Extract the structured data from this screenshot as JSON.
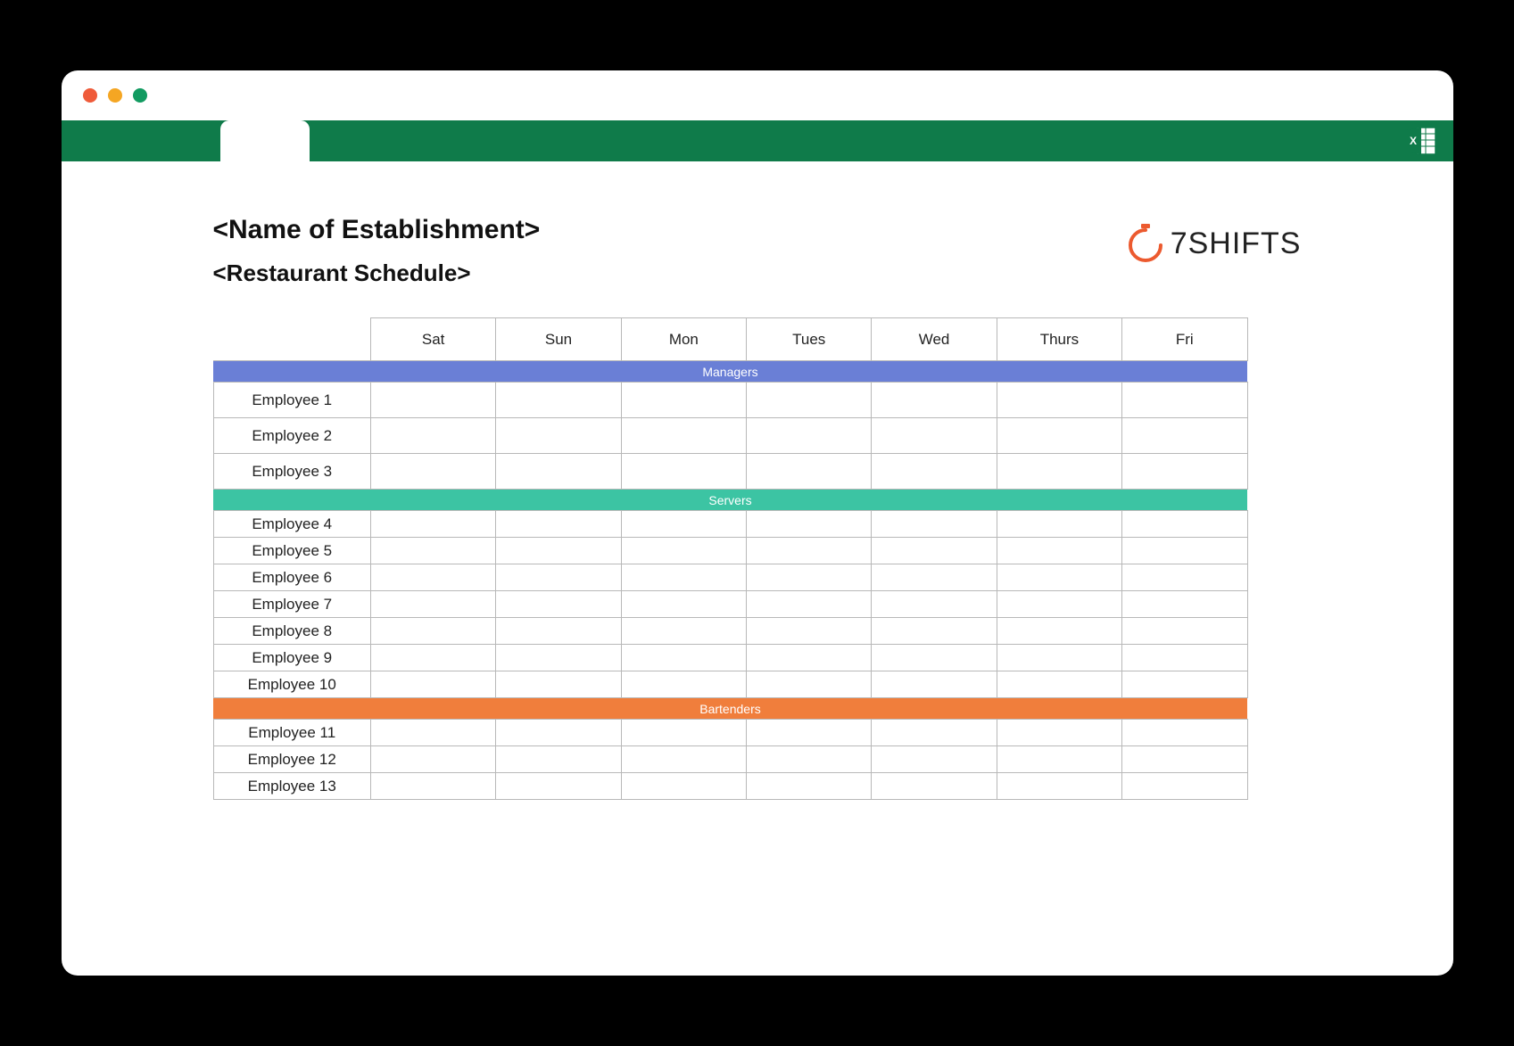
{
  "header": {
    "title": "<Name of Establishment>",
    "subtitle": "<Restaurant Schedule>",
    "logo_text": "7SHIFTS"
  },
  "days": [
    "Sat",
    "Sun",
    "Mon",
    "Tues",
    "Wed",
    "Thurs",
    "Fri"
  ],
  "sections": [
    {
      "name": "Managers",
      "color": "#6a7fd6",
      "employees": [
        "Employee 1",
        "Employee 2",
        "Employee 3"
      ]
    },
    {
      "name": "Servers",
      "color": "#3cc4a3",
      "employees": [
        "Employee 4",
        "Employee 5",
        "Employee 6",
        "Employee 7",
        "Employee 8",
        "Employee 9",
        "Employee 10"
      ]
    },
    {
      "name": "Bartenders",
      "color": "#f07e3c",
      "employees": [
        "Employee 11",
        "Employee 12",
        "Employee 13"
      ]
    }
  ]
}
